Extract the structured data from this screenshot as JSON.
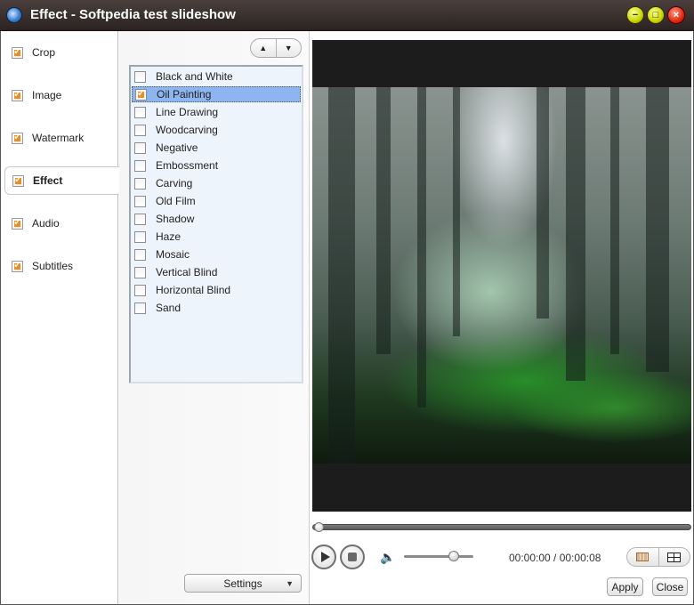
{
  "window": {
    "title": "Effect - Softpedia test slideshow",
    "icons": {
      "app": "film-reel-icon",
      "minimize": "minimize-icon",
      "maximize": "maximize-icon",
      "close": "close-icon"
    }
  },
  "nav": {
    "items": [
      {
        "label": "Crop",
        "checked": true
      },
      {
        "label": "Image",
        "checked": true
      },
      {
        "label": "Watermark",
        "checked": true
      },
      {
        "label": "Effect",
        "checked": true,
        "active": true
      },
      {
        "label": "Audio",
        "checked": true
      },
      {
        "label": "Subtitles",
        "checked": true
      }
    ]
  },
  "effects": {
    "items": [
      {
        "label": "Black and White",
        "checked": false
      },
      {
        "label": "Oil Painting",
        "checked": true,
        "selected": true
      },
      {
        "label": "Line Drawing",
        "checked": false
      },
      {
        "label": "Woodcarving",
        "checked": false
      },
      {
        "label": "Negative",
        "checked": false
      },
      {
        "label": "Embossment",
        "checked": false
      },
      {
        "label": "Carving",
        "checked": false
      },
      {
        "label": "Old Film",
        "checked": false
      },
      {
        "label": "Shadow",
        "checked": false
      },
      {
        "label": "Haze",
        "checked": false
      },
      {
        "label": "Mosaic",
        "checked": false
      },
      {
        "label": "Vertical Blind",
        "checked": false
      },
      {
        "label": "Horizontal Blind",
        "checked": false
      },
      {
        "label": "Sand",
        "checked": false
      }
    ],
    "move_up_icon": "arrow-up-icon",
    "move_down_icon": "arrow-down-icon",
    "settings_label": "Settings"
  },
  "player": {
    "progress": 0.0,
    "volume": 0.72,
    "time": "00:00:00 / 00:00:08",
    "icons": {
      "play": "play-icon",
      "stop": "stop-icon",
      "volume": "speaker-icon",
      "view1": "filmstrip-icon",
      "view2": "grid-icon"
    }
  },
  "footer": {
    "apply_label": "Apply",
    "close_label": "Close"
  },
  "colors": {
    "accent_check": "#f08c1e",
    "selection": "#8db6f0",
    "titlebar": "#3a302e"
  }
}
